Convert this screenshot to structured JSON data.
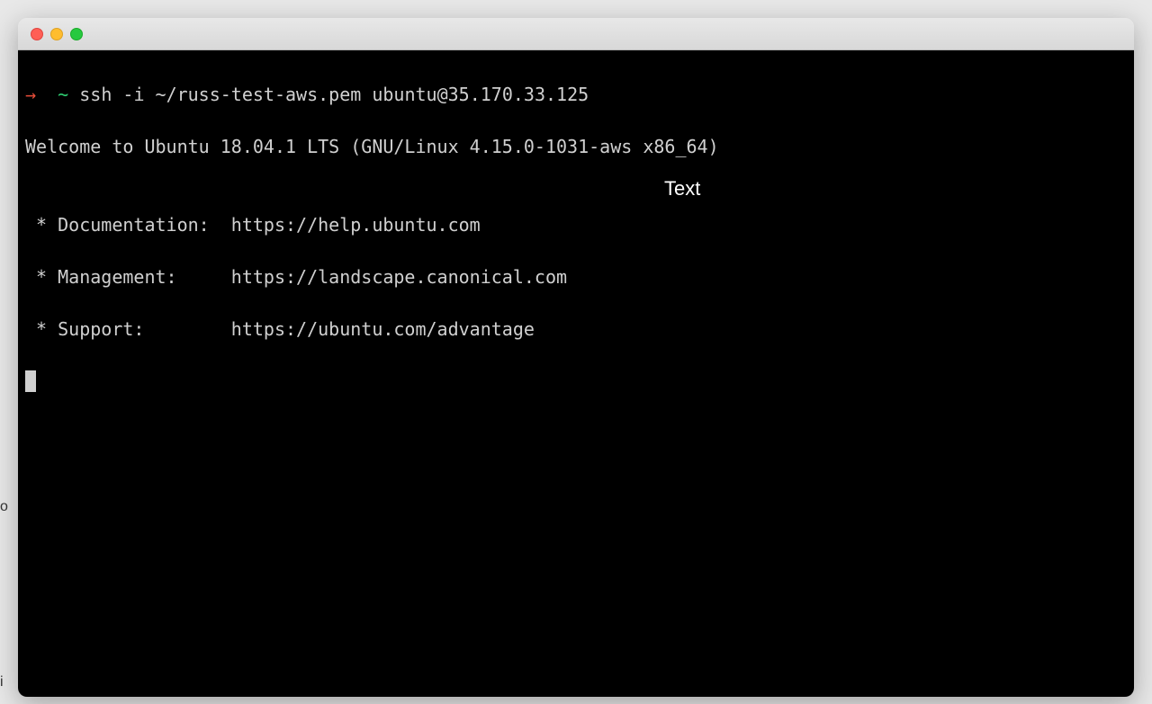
{
  "background": {
    "hint1": "o",
    "hint2": "i"
  },
  "terminal": {
    "prompt": {
      "arrow": "→",
      "tilde": "~",
      "command": "ssh -i ~/russ-test-aws.pem ubuntu@35.170.33.125"
    },
    "motd": {
      "welcome": "Welcome to Ubuntu 18.04.1 LTS (GNU/Linux 4.15.0-1031-aws x86_64)",
      "blank": "",
      "doc": " * Documentation:  https://help.ubuntu.com",
      "mgmt": " * Management:     https://landscape.canonical.com",
      "support": " * Support:        https://ubuntu.com/advantage"
    }
  },
  "overlay": {
    "text": "Text"
  }
}
